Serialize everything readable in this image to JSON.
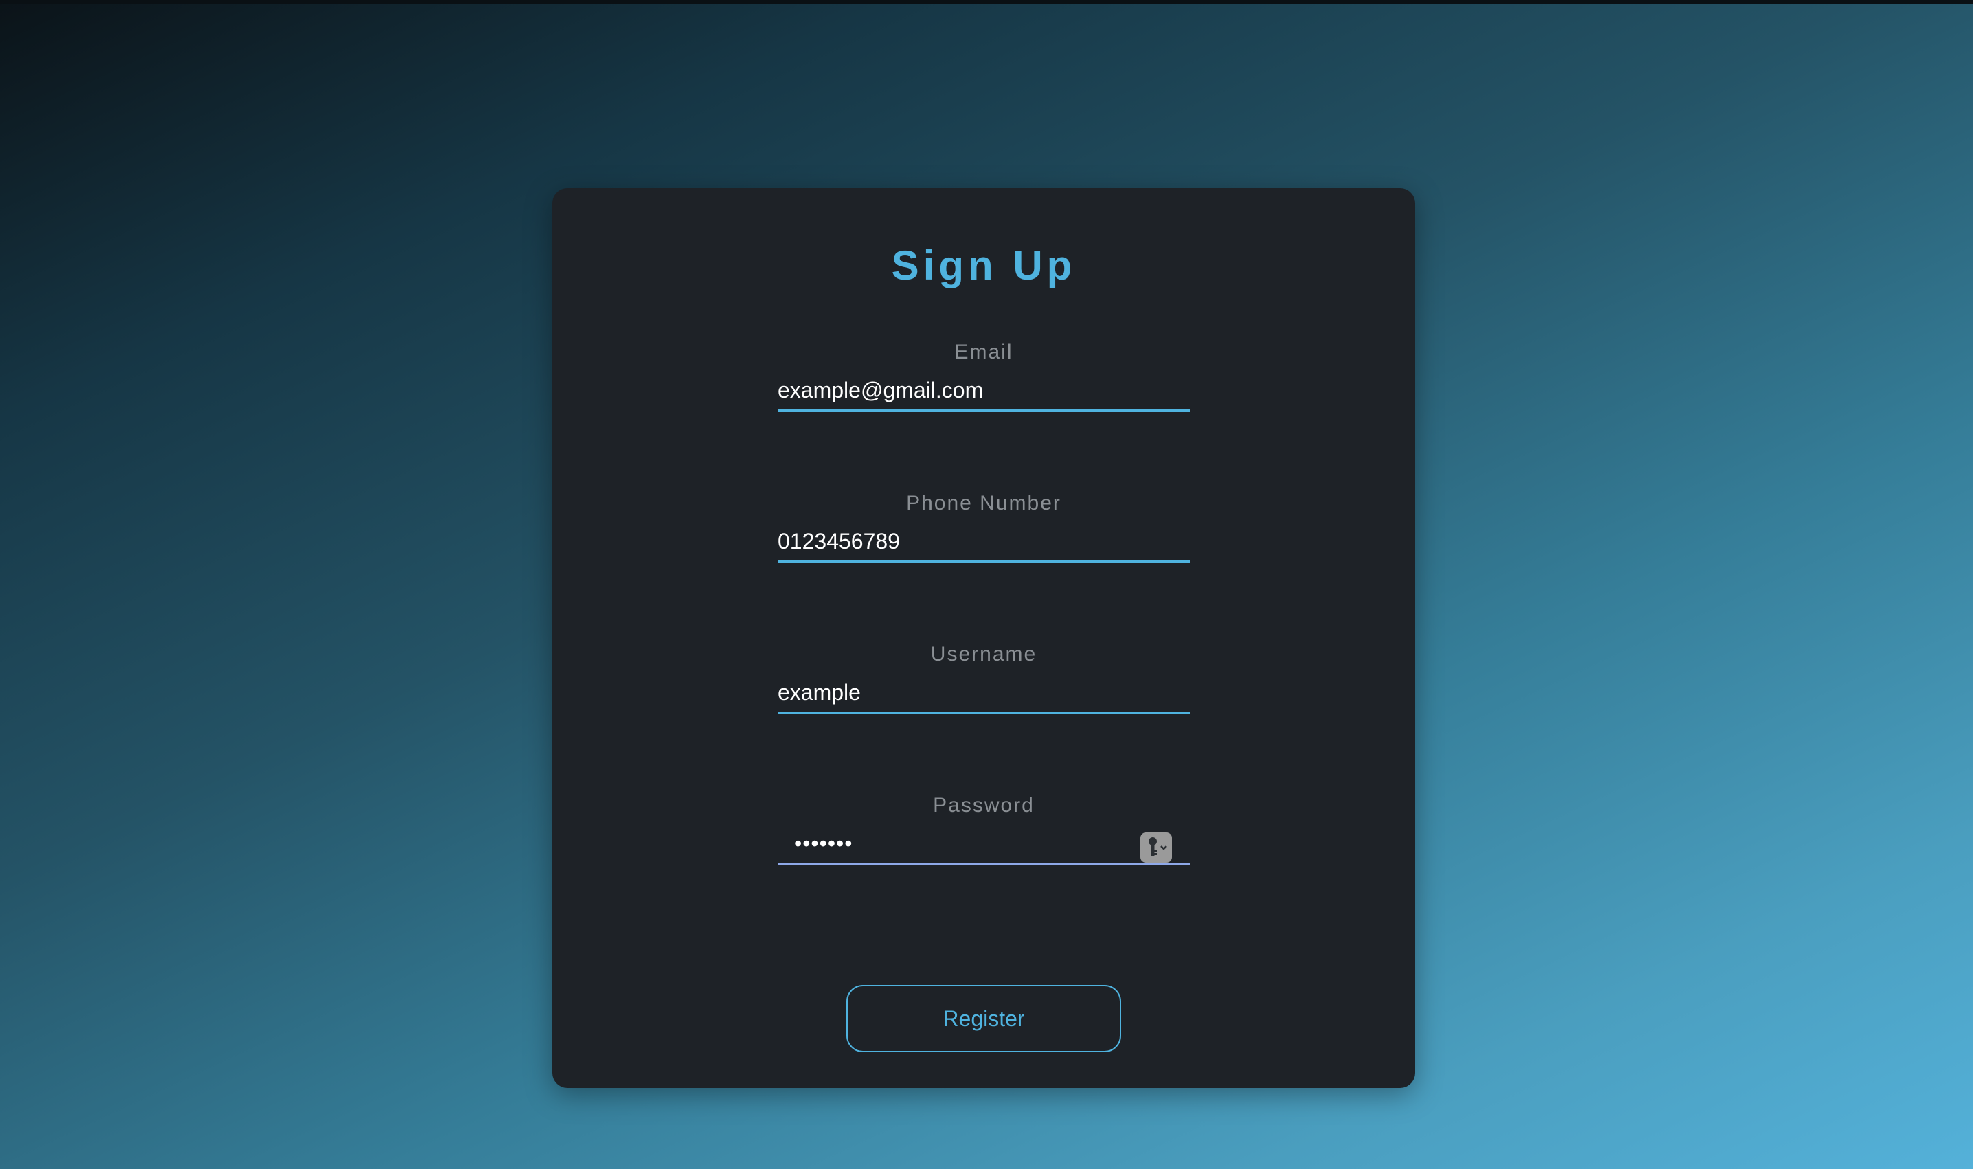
{
  "form": {
    "title": "Sign Up",
    "fields": [
      {
        "label": "Email",
        "value": "example@gmail.com",
        "type": "email"
      },
      {
        "label": "Phone Number",
        "value": "0123456789",
        "type": "tel"
      },
      {
        "label": "Username",
        "value": "example",
        "type": "text"
      },
      {
        "label": "Password",
        "value": "•••••••",
        "type": "password"
      }
    ],
    "password_manager_icon": "key-icon",
    "submit_label": "Register"
  },
  "colors": {
    "accent": "#4fb3df",
    "card_background": "#1e2227",
    "label_text": "#8a8f94",
    "password_underline": "#8ea8e8"
  }
}
